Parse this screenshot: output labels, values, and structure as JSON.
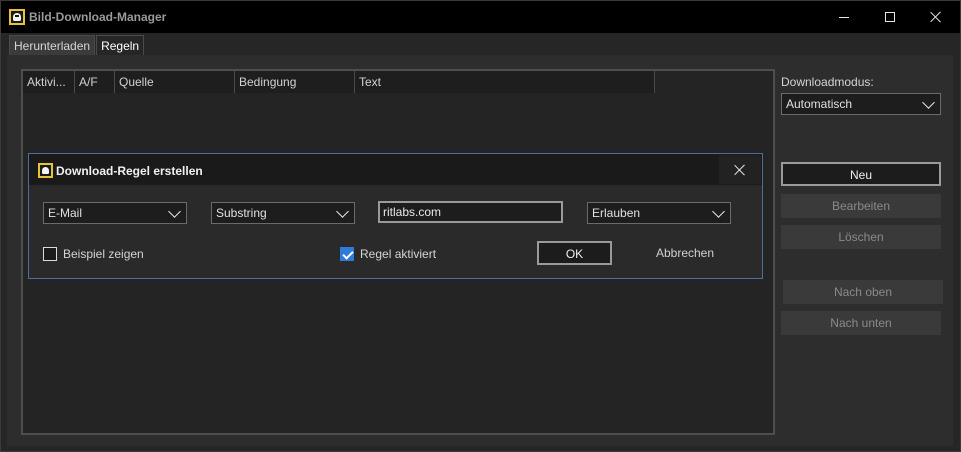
{
  "window": {
    "title": "Bild-Download-Manager"
  },
  "tabs": [
    {
      "label": "Herunterladen",
      "active": false
    },
    {
      "label": "Regeln",
      "active": true
    }
  ],
  "rule_list": {
    "columns": [
      "Aktivi...",
      "A/F",
      "Quelle",
      "Bedingung",
      "Text"
    ],
    "rows": []
  },
  "right_panel": {
    "download_mode_label": "Downloadmodus:",
    "download_mode_value": "Automatisch",
    "buttons": {
      "new": "Neu",
      "edit": "Bearbeiten",
      "delete": "Löschen",
      "move_up": "Nach oben",
      "move_down": "Nach unten"
    }
  },
  "dialog": {
    "title": "Download-Regel erstellen",
    "source_value": "E-Mail",
    "condition_value": "Substring",
    "text_value": "ritlabs.com",
    "action_value": "Erlauben",
    "show_example_label": "Beispiel zeigen",
    "show_example_checked": false,
    "rule_enabled_label": "Regel aktiviert",
    "rule_enabled_checked": true,
    "ok_label": "OK",
    "cancel_label": "Abbrechen"
  },
  "colors": {
    "accent": "#2f7bd9",
    "icon_frame": "#e8c33a",
    "dialog_border": "#4f6d9a"
  }
}
